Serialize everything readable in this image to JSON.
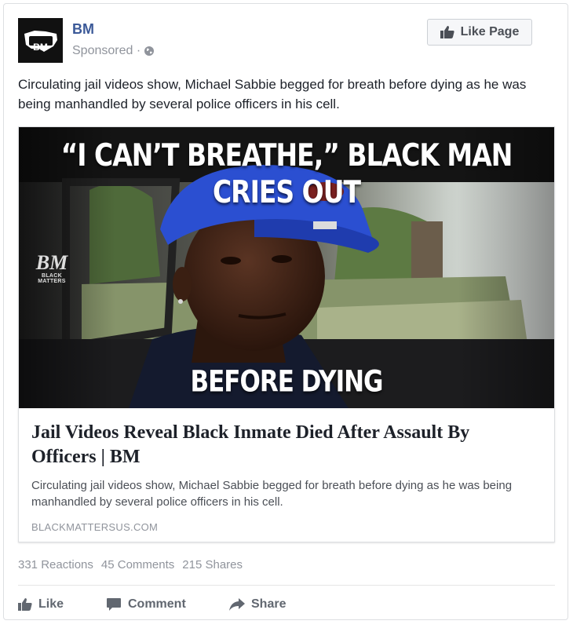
{
  "post": {
    "page_name": "BM",
    "avatar_text": "BM",
    "sponsored": "Sponsored · ",
    "like_page_label": "Like Page",
    "text": "Circulating jail videos show, Michael Sabbie begged for breath before dying as he was being manhandled by several police officers in his cell."
  },
  "link": {
    "image_headline_top": "“I CAN’T BREATHE,” BLACK MAN CRIES OUT",
    "image_headline_bottom": "BEFORE DYING",
    "watermark_logo": "BM",
    "watermark_sub": "BLACK MATTERS",
    "title": "Jail Videos Reveal Black Inmate Died After Assault By Officers | BM",
    "description": "Circulating jail videos show, Michael Sabbie begged for breath before dying as he was being manhandled by several police officers in his cell.",
    "domain": "BLACKMATTERSUS.COM"
  },
  "stats": {
    "reactions": "331 Reactions",
    "comments": "45 Comments",
    "shares": "215 Shares"
  },
  "actions": {
    "like": "Like",
    "comment": "Comment",
    "share": "Share"
  },
  "icons": {
    "globe": "globe-icon",
    "thumbs_up": "thumbs-up-icon",
    "comment": "comment-icon",
    "share": "share-arrow-icon"
  },
  "colors": {
    "page_name": "#3b5998",
    "muted": "#90949c",
    "hat_blue": "#2b4fd1"
  }
}
